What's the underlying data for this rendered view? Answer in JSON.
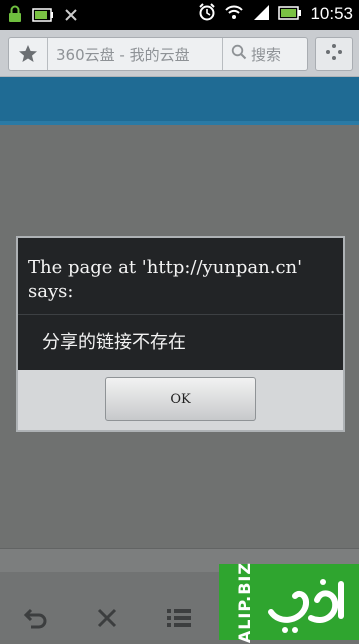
{
  "status_bar": {
    "time": "10:53",
    "left_icons": [
      "lock-icon",
      "battery-charge-icon",
      "usb-icon"
    ],
    "right_icons": [
      "alarm-icon",
      "wifi-icon",
      "signal-icon",
      "battery-icon"
    ]
  },
  "toolbar": {
    "page_title": "360云盘 - 我的云盘",
    "search_label": "搜索",
    "icons": [
      "bookmark-star-icon",
      "search-icon",
      "menu-icon"
    ]
  },
  "dialog": {
    "title": "The page at 'http://yunpan.cn' says:",
    "message": "分享的链接不存在",
    "ok_label": "OK"
  },
  "bottom_bar": {
    "icons": [
      "back-icon",
      "close-icon",
      "list-icon"
    ]
  },
  "watermark": {
    "brand": "ALIP.BIZ",
    "color": "#2fa52f"
  },
  "colors": {
    "header_blue": "#1f6b94",
    "dialog_bg": "#222426",
    "overlay": "#6f7170"
  }
}
